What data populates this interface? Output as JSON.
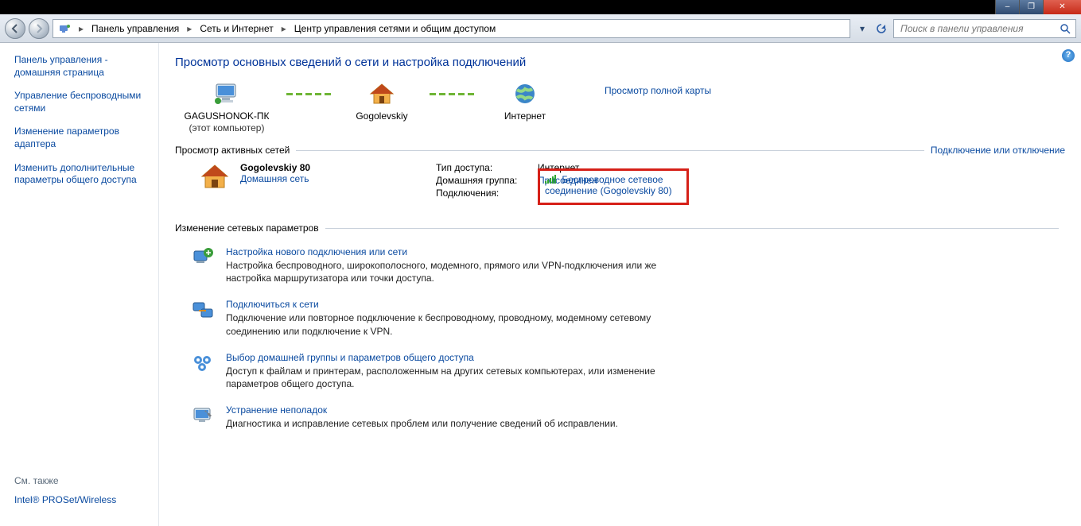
{
  "window": {
    "minimize": "–",
    "maximize": "❐",
    "close": "✕"
  },
  "breadcrumb": {
    "items": [
      "Панель управления",
      "Сеть и Интернет",
      "Центр управления сетями и общим доступом"
    ]
  },
  "search": {
    "placeholder": "Поиск в панели управления"
  },
  "sidebar": {
    "home": "Панель управления - домашняя страница",
    "items": [
      "Управление беспроводными сетями",
      "Изменение параметров адаптера",
      "Изменить дополнительные параметры общего доступа"
    ],
    "see_also_label": "См. также",
    "see_also_items": [
      "Intel® PROSet/Wireless"
    ]
  },
  "page": {
    "title": "Просмотр основных сведений о сети и настройка подключений",
    "full_map_link": "Просмотр полной карты",
    "map": {
      "this_pc": {
        "name": "GAGUSHONOK-ПК",
        "sub": "(этот компьютер)"
      },
      "gateway": {
        "name": "Gogolevskiy"
      },
      "internet": {
        "name": "Интернет"
      }
    },
    "active_header": "Просмотр активных сетей",
    "active_right_link": "Подключение или отключение",
    "active": {
      "network_name": "Gogolevskiy 80",
      "network_type": "Домашняя сеть",
      "rows": {
        "access_label": "Тип доступа:",
        "access_value": "Интернет",
        "homegroup_label": "Домашняя группа:",
        "homegroup_value": "Присоединен",
        "conn_label": "Подключения:",
        "conn_value": "Беспроводное сетевое соединение (Gogolevskiy 80)"
      }
    },
    "change_header": "Изменение сетевых параметров",
    "tasks": [
      {
        "title": "Настройка нового подключения или сети",
        "desc": "Настройка беспроводного, широкополосного, модемного, прямого или VPN-подключения или же настройка маршрутизатора или точки доступа."
      },
      {
        "title": "Подключиться к сети",
        "desc": "Подключение или повторное подключение к беспроводному, проводному, модемному сетевому соединению или подключение к VPN."
      },
      {
        "title": "Выбор домашней группы и параметров общего доступа",
        "desc": "Доступ к файлам и принтерам, расположенным на других сетевых компьютерах, или изменение параметров общего доступа."
      },
      {
        "title": "Устранение неполадок",
        "desc": "Диагностика и исправление сетевых проблем или получение сведений об исправлении."
      }
    ]
  }
}
